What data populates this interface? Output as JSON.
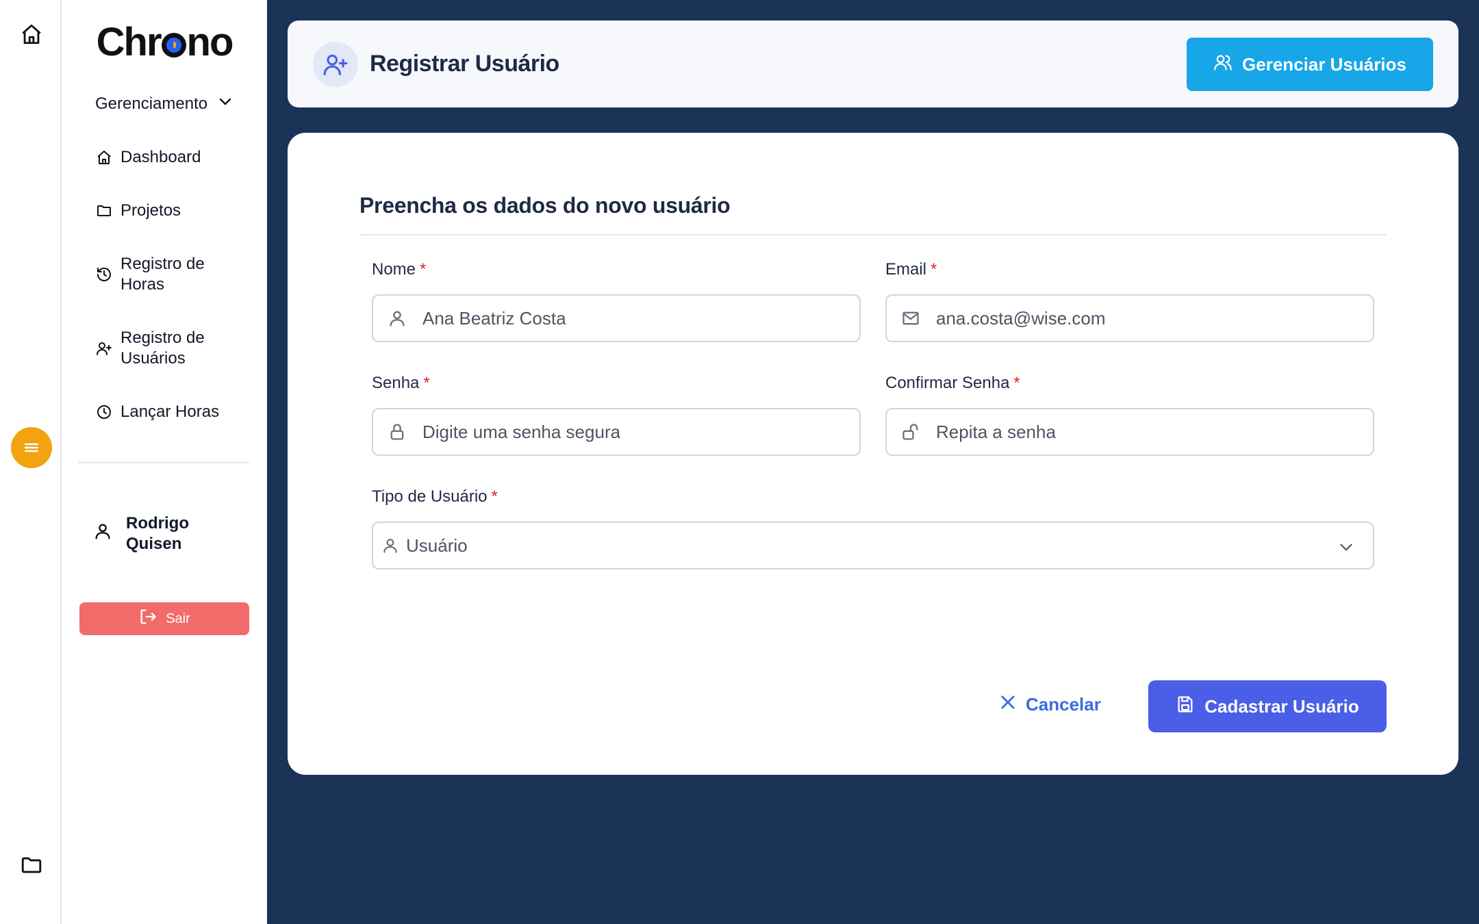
{
  "app": {
    "name": "Chrono"
  },
  "colors": {
    "background": "#1c3358",
    "accent_yellow": "#f2a30f",
    "manage_button": "#17a6e8",
    "submit_button": "#4a5ee8",
    "logout_button": "#f26b6b",
    "required": "#dc2626",
    "cancel_link": "#3b6ce0"
  },
  "rail": {
    "home_icon": "home-icon",
    "menu_icon": "menu-icon",
    "folder_icon": "folder-icon"
  },
  "sidebar": {
    "logo_parts": [
      "Chr",
      "no"
    ],
    "group_title": "Gerenciamento",
    "items": [
      {
        "label": "Dashboard",
        "icon": "home-icon"
      },
      {
        "label": "Projetos",
        "icon": "folder-icon"
      },
      {
        "label": "Registro de Horas",
        "icon": "history-icon"
      },
      {
        "label": "Registro de Usuários",
        "icon": "user-plus-icon"
      },
      {
        "label": "Lançar Horas",
        "icon": "clock-icon"
      }
    ],
    "user_name": "Rodrigo Quisen",
    "logout_label": "Sair"
  },
  "header": {
    "title": "Registrar Usuário",
    "manage_button": "Gerenciar Usuários"
  },
  "form": {
    "heading": "Preencha os dados do novo usuário",
    "required_mark": "*",
    "name": {
      "label": "Nome",
      "value": "Ana Beatriz Costa"
    },
    "email": {
      "label": "Email",
      "value": "ana.costa@wise.com"
    },
    "password": {
      "label": "Senha",
      "placeholder": "Digite uma senha segura"
    },
    "confirm_password": {
      "label": "Confirmar Senha",
      "placeholder": "Repita a senha"
    },
    "user_type": {
      "label": "Tipo de Usuário",
      "selected": "Usuário"
    },
    "cancel_label": "Cancelar",
    "submit_label": "Cadastrar Usuário"
  }
}
